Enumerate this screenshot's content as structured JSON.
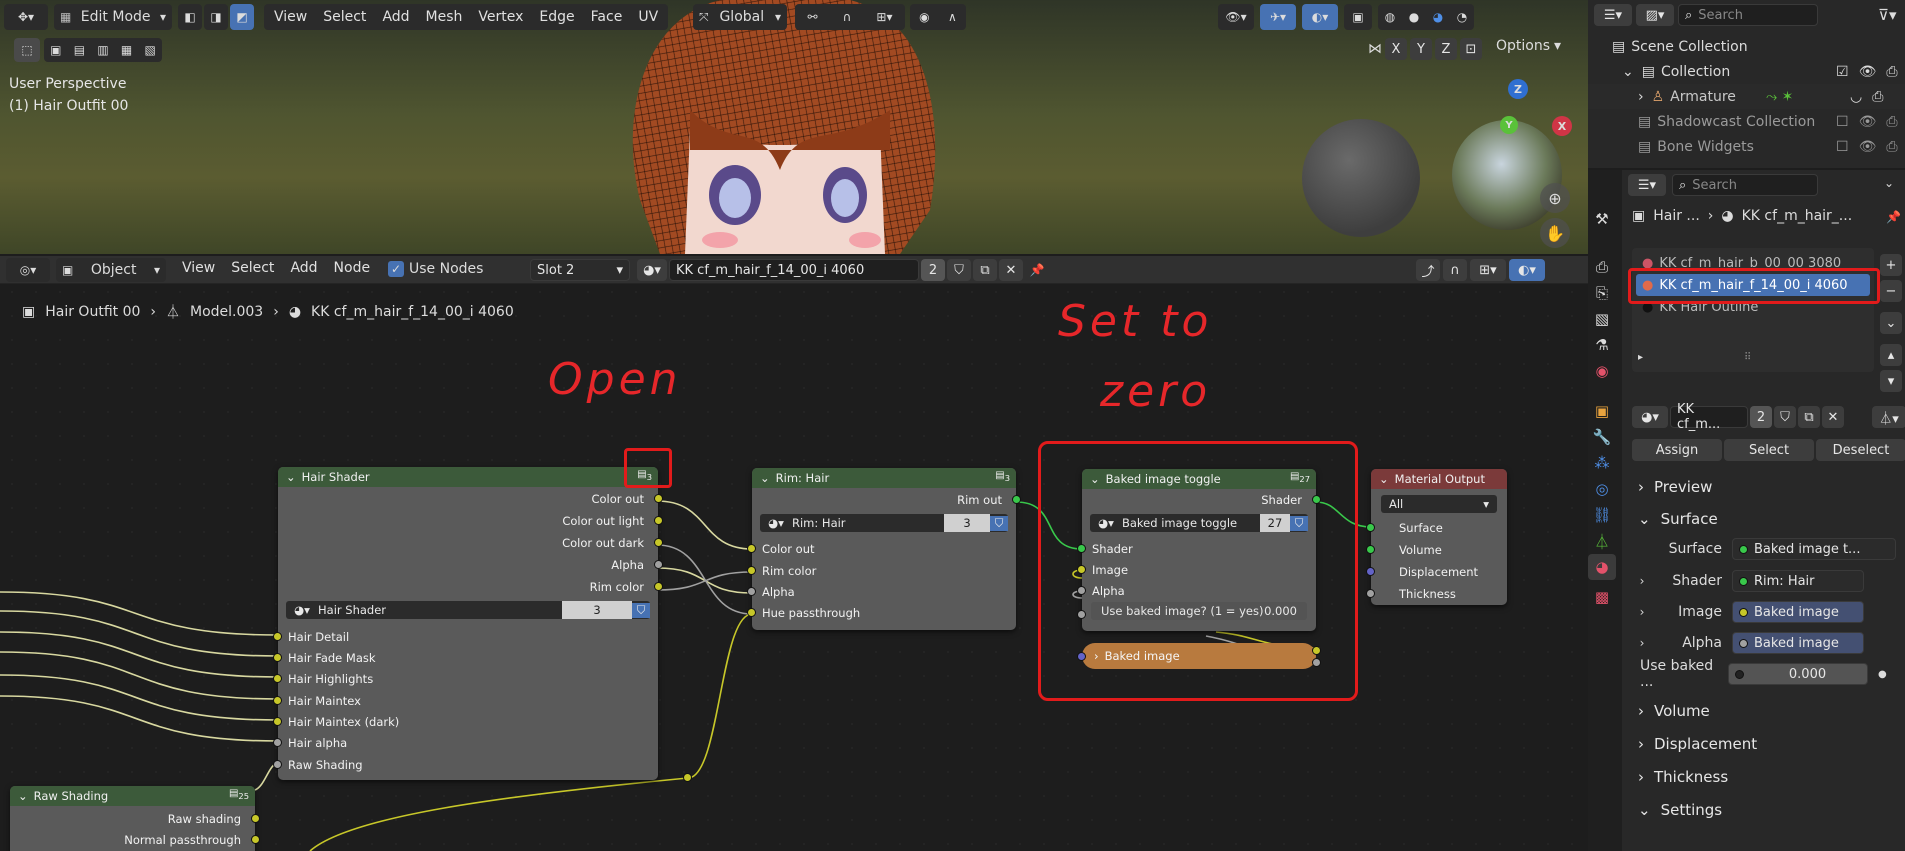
{
  "viewport": {
    "mode": "Edit Mode",
    "menus": [
      "View",
      "Select",
      "Add",
      "Mesh",
      "Vertex",
      "Edge",
      "Face",
      "UV"
    ],
    "orientation": "Global",
    "perspective": "User Perspective",
    "object_info": "(1) Hair Outfit 00",
    "axes": [
      "X",
      "Y",
      "Z"
    ],
    "options_label": "Options",
    "gizmo_z": "Z",
    "gizmo_y": "Y",
    "gizmo_x": "X"
  },
  "outliner": {
    "search_placeholder": "Search",
    "items": [
      {
        "label": "Scene Collection"
      },
      {
        "label": "Collection"
      },
      {
        "label": "Armature"
      },
      {
        "label": "Shadowcast Collection"
      },
      {
        "label": "Bone Widgets"
      }
    ]
  },
  "node_editor": {
    "object_mode": "Object",
    "menus": [
      "View",
      "Select",
      "Add",
      "Node"
    ],
    "use_nodes_label": "Use Nodes",
    "slot": "Slot 2",
    "material_name": "KK cf_m_hair_f_14_00_i 4060",
    "material_users": "2",
    "breadcrumb": [
      "Hair Outfit 00",
      "Model.003",
      "KK cf_m_hair_f_14_00_i 4060"
    ],
    "nodes": {
      "hair_shader": {
        "title": "Hair Shader",
        "users": "3",
        "outputs": [
          "Color out",
          "Color out light",
          "Color out dark",
          "Alpha",
          "Rim color"
        ],
        "group_name": "Hair Shader",
        "group_users": "3",
        "inputs": [
          "Hair Detail",
          "Hair Fade Mask",
          "Hair Highlights",
          "Hair Maintex",
          "Hair Maintex (dark)",
          "Hair alpha",
          "Raw Shading"
        ]
      },
      "rim": {
        "title": "Rim: Hair",
        "users": "3",
        "output": "Rim out",
        "group_name": "Rim: Hair",
        "group_users": "3",
        "inputs": [
          "Color out",
          "Rim color",
          "Alpha",
          "Hue passthrough"
        ]
      },
      "baked": {
        "title": "Baked image toggle",
        "users": "27",
        "output": "Shader",
        "group_name": "Baked image toggle",
        "group_users": "27",
        "inputs": [
          "Shader",
          "Image",
          "Alpha"
        ],
        "toggle_label": "Use baked image? (1 = yes)",
        "toggle_value": "0.000"
      },
      "baked_frame": {
        "title": "Baked image"
      },
      "material_output": {
        "title": "Material Output",
        "target": "All",
        "inputs": [
          "Surface",
          "Volume",
          "Displacement",
          "Thickness"
        ]
      },
      "raw_shading": {
        "title": "Raw Shading",
        "users": "25",
        "outputs": [
          "Raw shading",
          "Normal passthrough"
        ]
      }
    }
  },
  "annotations": {
    "open": "Open",
    "set_to": "Set to",
    "zero": "zero"
  },
  "properties": {
    "search_placeholder": "Search",
    "breadcrumb_obj": "Hair ...",
    "breadcrumb_mat": "KK cf_m_hair_...",
    "material_slots": [
      "KK cf_m_hair_b_00_00 3080",
      "KK cf_m_hair_f_14_00_i 4060",
      "KK Hair Outline"
    ],
    "mat_name_short": "KK cf_m...",
    "mat_users": "2",
    "assign_label": "Assign",
    "select_label": "Select",
    "deselect_label": "Deselect",
    "sections": [
      "Preview",
      "Surface",
      "Volume",
      "Displacement",
      "Thickness",
      "Settings"
    ],
    "surface_label": "Surface",
    "surface_value": "Baked image t...",
    "shader_label": "Shader",
    "shader_value": "Rim: Hair",
    "image_label": "Image",
    "image_value": "Baked image",
    "alpha_label": "Alpha",
    "alpha_value": "Baked image",
    "use_baked_label": "Use baked ...",
    "use_baked_value": "0.000"
  },
  "colors": {
    "annotation_red": "#e21b1b",
    "selection_blue": "#4772b3",
    "group_header": "#3c5a3a",
    "output_header": "#7b3a3a"
  }
}
